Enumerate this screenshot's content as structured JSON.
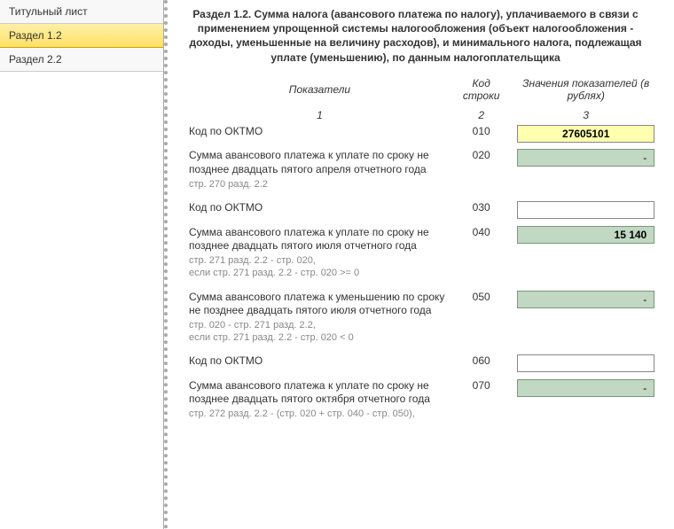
{
  "sidebar": {
    "items": [
      {
        "label": "Титульный лист"
      },
      {
        "label": "Раздел 1.2"
      },
      {
        "label": "Раздел 2.2"
      }
    ],
    "active_index": 1
  },
  "section": {
    "title": "Раздел 1.2. Сумма налога (авансового платежа по налогу), уплачиваемого в связи с применением упрощенной системы налогообложения (объект налогообложения - доходы, уменьшенные на величину расходов), и минимального налога, подлежащая уплате (уменьшению), по данным налогоплательщика"
  },
  "columns": {
    "c1_header": "Показатели",
    "c2_header": "Код строки",
    "c3_header": "Значения показателей (в рублях)",
    "c1_num": "1",
    "c2_num": "2",
    "c3_num": "3"
  },
  "rows": [
    {
      "label": "Код по ОКТМО",
      "subnote": "",
      "code": "010",
      "value": "27605101",
      "style": "yellow"
    },
    {
      "label": "Сумма авансового платежа к уплате по сроку не позднее двадцать пятого апреля отчетного года",
      "subnote": "стр. 270 разд. 2.2",
      "code": "020",
      "value": "-",
      "style": "green"
    },
    {
      "label": "Код по ОКТМО",
      "subnote": "",
      "code": "030",
      "value": "",
      "style": "white"
    },
    {
      "label": "Сумма  авансового платежа к уплате по сроку не позднее двадцать пятого июля отчетного года",
      "subnote": "стр. 271 разд. 2.2 - стр. 020,\nесли стр. 271 разд. 2.2 - стр. 020 >= 0",
      "code": "040",
      "value": "15 140",
      "style": "green-bold"
    },
    {
      "label": "Сумма авансового платежа к уменьшению по сроку не позднее двадцать пятого июля отчетного года",
      "subnote": "стр. 020 - стр. 271 разд. 2.2,\nесли стр. 271 разд. 2.2 - стр. 020 < 0",
      "code": "050",
      "value": "-",
      "style": "green"
    },
    {
      "label": "Код по ОКТМО",
      "subnote": "",
      "code": "060",
      "value": "",
      "style": "white"
    },
    {
      "label": "Сумма авансового платежа к уплате по сроку не позднее двадцать пятого октября отчетного года",
      "subnote": "стр. 272 разд. 2.2 - (стр. 020 + стр. 040 - стр. 050),",
      "code": "070",
      "value": "-",
      "style": "green"
    }
  ]
}
